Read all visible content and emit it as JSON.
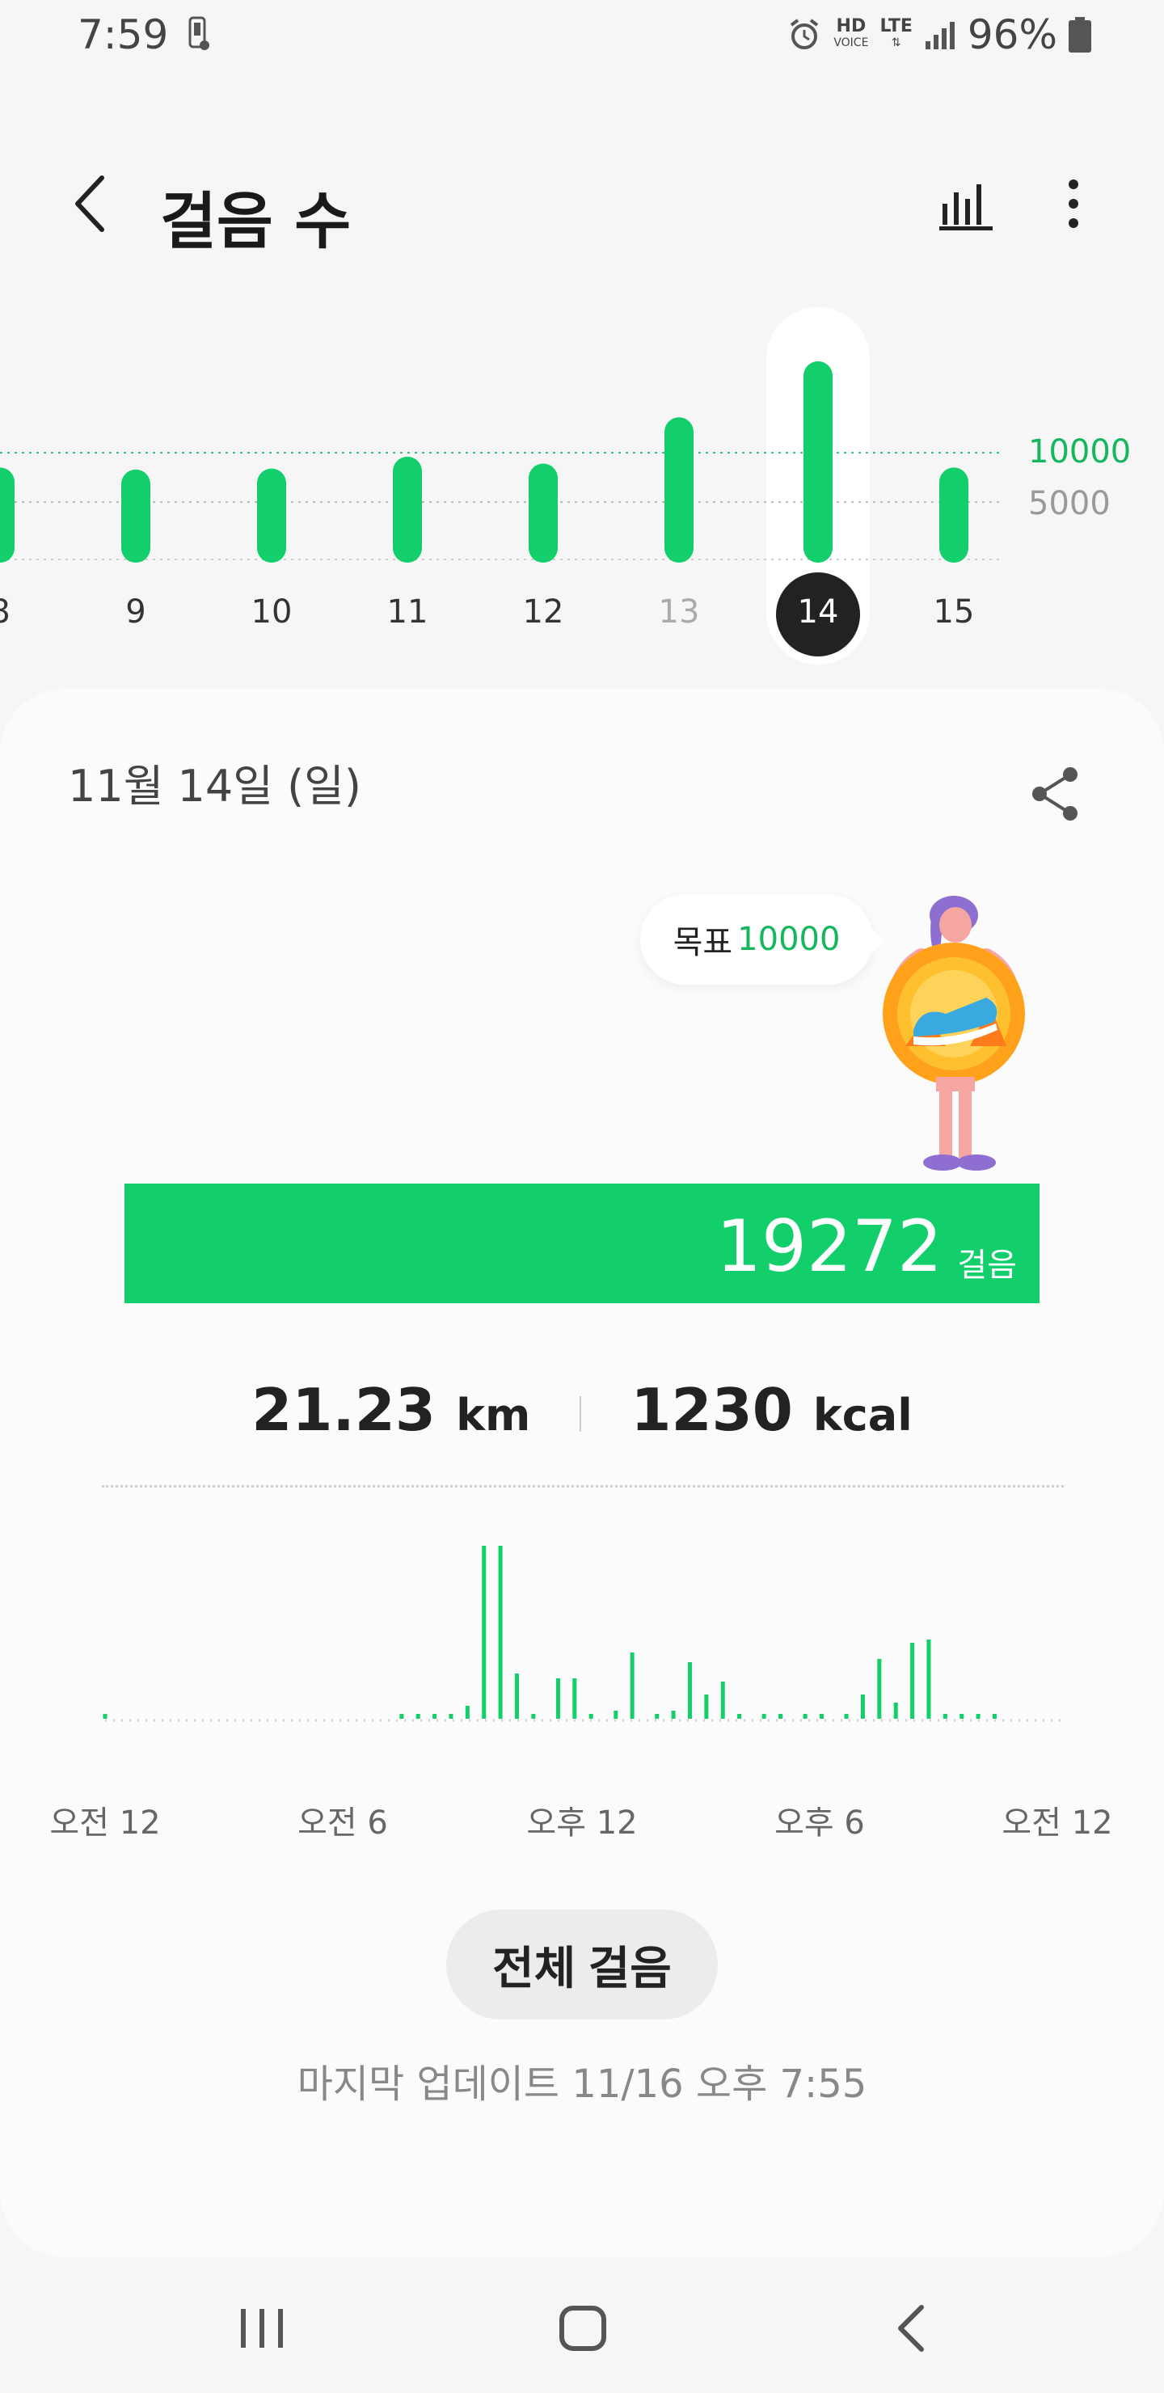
{
  "status_bar": {
    "time": "7:59",
    "network": "HD",
    "network_sub": "VOICE",
    "lte": "LTE",
    "battery": "96%"
  },
  "header": {
    "title": "걸음 수",
    "back_icon": "back-arrow-icon",
    "chart_icon": "bar-chart-icon",
    "more_icon": "more-vert-icon"
  },
  "week_strip": {
    "goal_line_label": "10000",
    "half_goal_label": "5000",
    "days": [
      {
        "label": "8",
        "value": 8500
      },
      {
        "label": "9",
        "value": 8300
      },
      {
        "label": "10",
        "value": 8400
      },
      {
        "label": "11",
        "value": 9600
      },
      {
        "label": "12",
        "value": 8900
      },
      {
        "label": "13",
        "value": 13600
      },
      {
        "label": "14",
        "value": 19272,
        "selected": true
      },
      {
        "label": "15",
        "value": 8500
      }
    ],
    "colors": {
      "bar": "#13cf6b",
      "selected_pill": "#ffffff",
      "selected_day": "#222222"
    }
  },
  "detail": {
    "date": "11월 14일 (일)",
    "share_icon": "share-icon",
    "goal_prefix": "목표",
    "goal_value": "10000",
    "steps": "19272",
    "steps_unit": "걸음",
    "distance": "21.23",
    "distance_unit": "km",
    "calories": "1230",
    "calories_unit": "kcal",
    "hourly_axis": [
      "오전 12",
      "오전 6",
      "오후 12",
      "오후 6",
      "오전 12"
    ],
    "hourly_steps": [
      20,
      0,
      0,
      0,
      0,
      0,
      0,
      0,
      0,
      0,
      0,
      0,
      0,
      0,
      0,
      0,
      0,
      0,
      0,
      0,
      0,
      0,
      0,
      0,
      0,
      0,
      0,
      0,
      0,
      0,
      0,
      0,
      0,
      0,
      0,
      0,
      0,
      0,
      0,
      0,
      0,
      0,
      0,
      0,
      0,
      0,
      0,
      0,
      0,
      0,
      0,
      0,
      0,
      0,
      0,
      0,
      0,
      0,
      0,
      0,
      0,
      0,
      0,
      0,
      0,
      0,
      0,
      0,
      0,
      0,
      0,
      0,
      0,
      0,
      0,
      0,
      0,
      0,
      0,
      0,
      0,
      0,
      0,
      0,
      0,
      0,
      0,
      0,
      0,
      0,
      0,
      0,
      0,
      0,
      0,
      0
    ],
    "all_steps_button": "전체 걸음",
    "last_update": "마지막 업데이트 11/16 오후 7:55",
    "accent_color": "#13cf6b"
  },
  "nav_bar": {
    "recent_icon": "recent-apps-icon",
    "home_icon": "home-icon",
    "back_icon": "back-icon"
  }
}
